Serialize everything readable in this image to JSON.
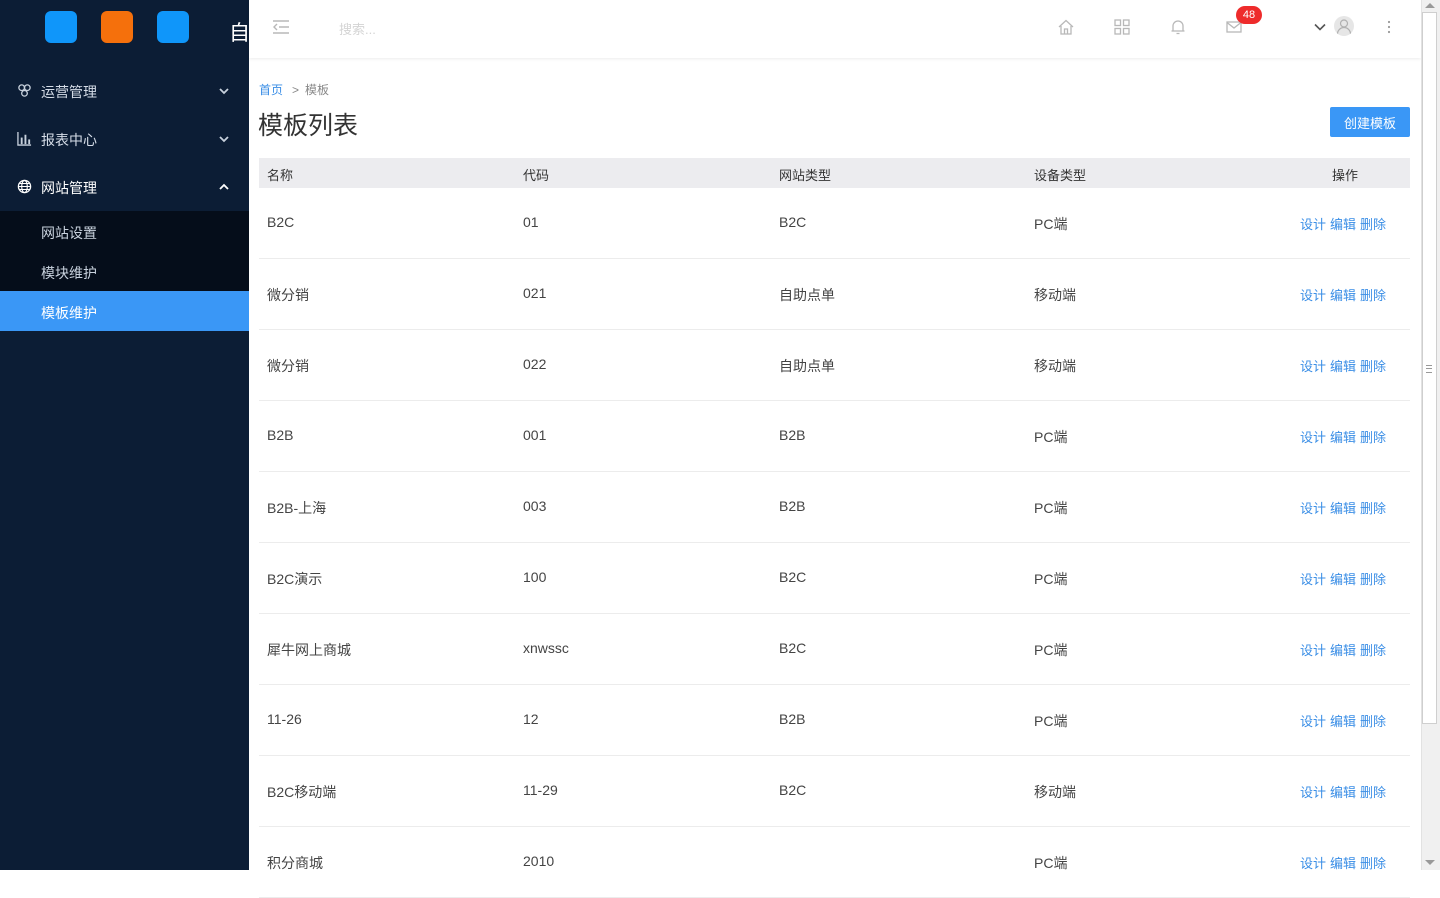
{
  "sidebar": {
    "logo_squares": [
      "#0f96fa",
      "#f5700c",
      "#0f96fa"
    ],
    "logo_title": "自",
    "menu": [
      {
        "label": "运营管理",
        "icon": "cluster-icon",
        "open": false
      },
      {
        "label": "报表中心",
        "icon": "bar-chart-icon",
        "open": false
      },
      {
        "label": "网站管理",
        "icon": "globe-icon",
        "open": true
      }
    ],
    "submenu": [
      {
        "label": "网站设置",
        "active": false
      },
      {
        "label": "模块维护",
        "active": false
      },
      {
        "label": "模板维护",
        "active": true
      }
    ]
  },
  "header": {
    "search_placeholder": "搜索...",
    "icons": [
      "menu-fold-icon",
      "home-icon",
      "apps-grid-icon",
      "bell-icon",
      "mail-icon",
      "chevron-down-icon",
      "user-avatar-icon",
      "more-vertical-icon"
    ],
    "mail_badge": "48"
  },
  "breadcrumb": {
    "home": "首页",
    "separator": ">",
    "current": "模板"
  },
  "page": {
    "title": "模板列表",
    "create_button": "创建模板"
  },
  "table": {
    "headers": [
      "名称",
      "代码",
      "网站类型",
      "设备类型",
      "操作"
    ],
    "rows": [
      [
        "B2C",
        "01",
        "B2C",
        "PC端"
      ],
      [
        "微分销",
        "021",
        "自助点单",
        "移动端"
      ],
      [
        "微分销",
        "022",
        "自助点单",
        "移动端"
      ],
      [
        "B2B",
        "001",
        "B2B",
        "PC端"
      ],
      [
        "B2B-上海",
        "003",
        "B2B",
        "PC端"
      ],
      [
        "B2C演示",
        "100",
        "B2C",
        "PC端"
      ],
      [
        "犀牛网上商城",
        "xnwssc",
        "B2C",
        "PC端"
      ],
      [
        "11-26",
        "12",
        "B2B",
        "PC端"
      ],
      [
        "B2C移动端",
        "11-29",
        "B2C",
        "移动端"
      ],
      [
        "积分商城",
        "2010",
        "",
        "PC端"
      ]
    ],
    "actions": [
      "设计",
      "编辑",
      "删除"
    ]
  },
  "colors": {
    "accent": "#3a97f6",
    "sidebar_bg": "#0c1d35",
    "link": "#3a8ee6",
    "badge": "#ee2b2b"
  }
}
